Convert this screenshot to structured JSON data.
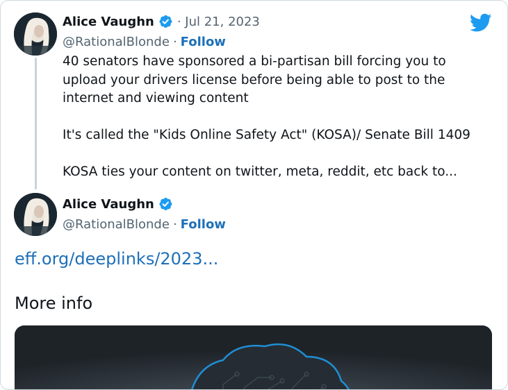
{
  "brand": {
    "twitter_blue": "#1d9bf0",
    "link_color": "#1d6fb8"
  },
  "tweet": {
    "author_name": "Alice Vaughn",
    "handle": "@RationalBlonde",
    "separator": "·",
    "date": "· Jul 21, 2023",
    "follow_label": "Follow",
    "verified_icon": "verified-badge-icon",
    "paragraphs": [
      "40 senators have sponsored a bi-partisan bill forcing you to upload your drivers license before being able to post to the internet and viewing content",
      "It's called the \"Kids Online Safety Act\" (KOSA)/ Senate Bill 1409",
      "KOSA ties your content on twitter, meta, reddit, etc back to..."
    ]
  },
  "reply": {
    "author_name": "Alice Vaughn",
    "handle": "@RationalBlonde",
    "separator": "·",
    "follow_label": "Follow",
    "verified_icon": "verified-badge-icon",
    "link_text": "eff.org/deeplinks/2023...",
    "more_info_label": "More info"
  },
  "icons": {
    "logo": "twitter-bird-icon"
  }
}
